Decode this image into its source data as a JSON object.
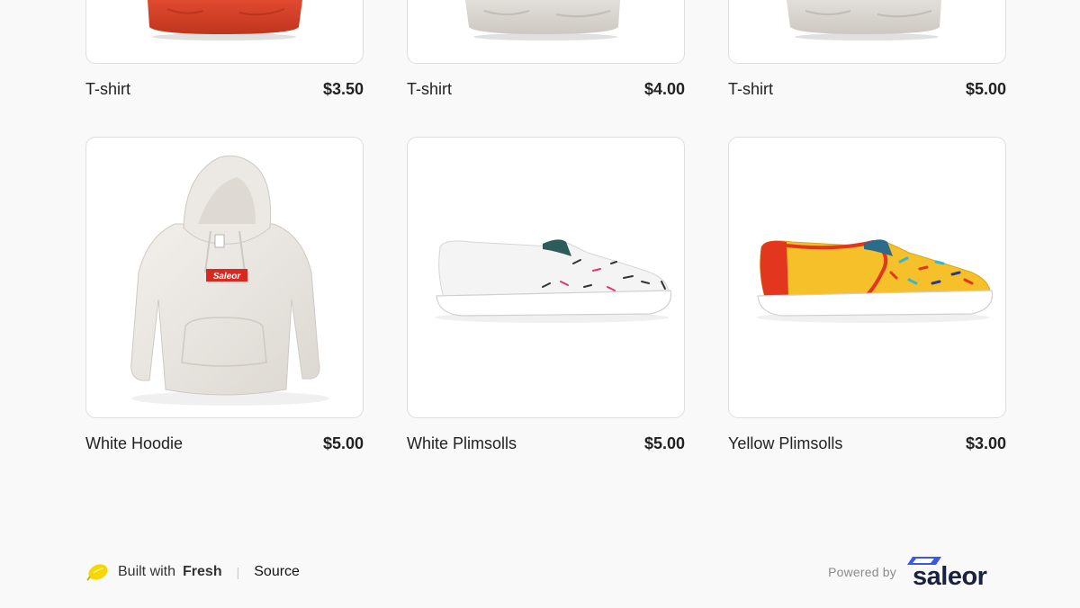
{
  "products_top": [
    {
      "name": "T-shirt",
      "price": "$3.50",
      "image": "red-tshirt"
    },
    {
      "name": "T-shirt",
      "price": "$4.00",
      "image": "grey-tshirt"
    },
    {
      "name": "T-shirt",
      "price": "$5.00",
      "image": "grey-tshirt"
    }
  ],
  "products": [
    {
      "name": "White Hoodie",
      "price": "$5.00",
      "image": "white-hoodie",
      "brand_label": "Saleor"
    },
    {
      "name": "White Plimsolls",
      "price": "$5.00",
      "image": "white-plimsoll"
    },
    {
      "name": "Yellow Plimsolls",
      "price": "$3.00",
      "image": "yellow-plimsoll"
    }
  ],
  "footer": {
    "built_with": "Built with",
    "fresh": "Fresh",
    "separator": "|",
    "source": "Source",
    "powered_by": "Powered by",
    "logo_text": "saleor",
    "logo_icon": "lemon-icon"
  },
  "colors": {
    "page_bg": "#f9f9f9",
    "card_border": "#dedede",
    "lemon": "#f5d800",
    "saleor_navy": "#1a2140",
    "saleor_blue": "#3a57e8"
  }
}
